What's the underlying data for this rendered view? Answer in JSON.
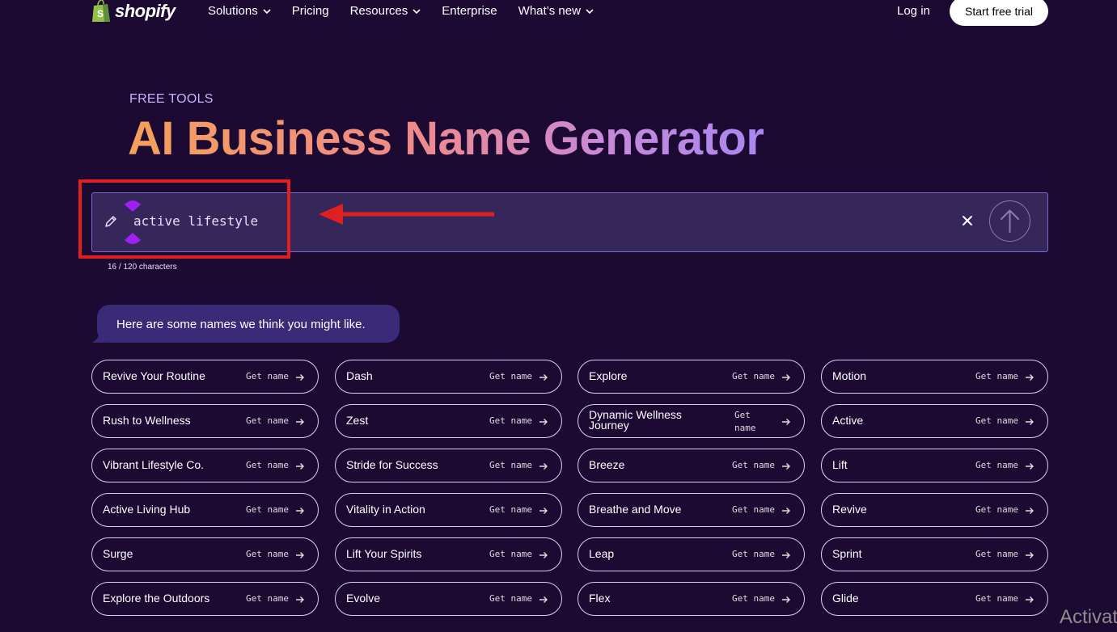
{
  "nav": {
    "logo_text": "shopify",
    "menu": [
      {
        "label": "Solutions",
        "has_chevron": true
      },
      {
        "label": "Pricing",
        "has_chevron": false
      },
      {
        "label": "Resources",
        "has_chevron": true
      },
      {
        "label": "Enterprise",
        "has_chevron": false
      },
      {
        "label": "What’s new",
        "has_chevron": true
      }
    ],
    "login_label": "Log in",
    "trial_label": "Start free trial"
  },
  "header": {
    "eyebrow": "FREE TOOLS",
    "title": "AI Business Name Generator"
  },
  "prompt": {
    "value": "active lifestyle",
    "counter": "16 / 120 characters",
    "icons": {
      "edit": "pencil-icon",
      "clear": "close-icon",
      "submit": "arrow-up-icon"
    }
  },
  "bubble": {
    "text": "Here are some names we think you might like."
  },
  "results": {
    "get_label": "Get name",
    "columns": [
      [
        "Revive Your Routine",
        "Rush to Wellness",
        "Vibrant Lifestyle Co.",
        "Active Living Hub",
        "Surge",
        "Explore the Outdoors"
      ],
      [
        "Dash",
        "Zest",
        "Stride for Success",
        "Vitality in Action",
        "Lift Your Spirits",
        "Evolve"
      ],
      [
        "Explore",
        "Dynamic Wellness Journey",
        "Breeze",
        "Breathe and Move",
        "Leap",
        "Flex"
      ],
      [
        "Motion",
        "Active",
        "Lift",
        "Revive",
        "Sprint",
        "Glide"
      ]
    ]
  },
  "overlay": {
    "watermark": "Activat",
    "annotation_color": "#e0201f"
  },
  "colors": {
    "background": "#1c0a33",
    "input_bg": "#36275a",
    "bubble_bg": "#3a2a78",
    "eyebrow": "#c9b2ff",
    "cursor_purple": "#a020f0"
  }
}
